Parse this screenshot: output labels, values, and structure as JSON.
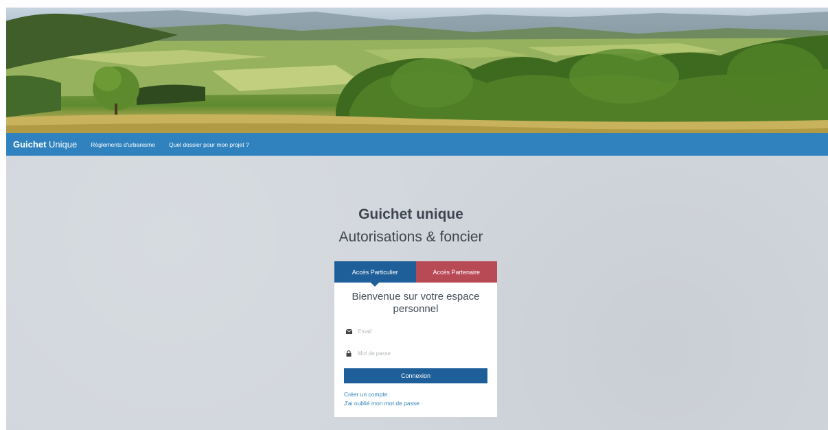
{
  "navbar": {
    "brand_bold": "Guichet",
    "brand_light": "Unique",
    "links": [
      "Règlements d'urbanisme",
      "Quel dossier pour mon projet ?"
    ]
  },
  "heading": {
    "title": "Guichet unique",
    "subtitle": "Autorisations & foncier"
  },
  "login": {
    "tabs": [
      "Accès Particulier",
      "Accès Partenaire"
    ],
    "welcome": "Bienvenue sur votre espace personnel",
    "email_placeholder": "Email",
    "email_icon": "envelope-icon",
    "password_placeholder": "Mot de passe",
    "password_icon": "lock-icon",
    "submit_label": "Connexion",
    "create_account": "Créer un compte",
    "forgot_password": "J'ai oublié mon mot de passe"
  },
  "colors": {
    "navbar": "#2f82bd",
    "primary": "#1f5f99",
    "partner": "#b84a55",
    "background": "#d2d7dd"
  }
}
